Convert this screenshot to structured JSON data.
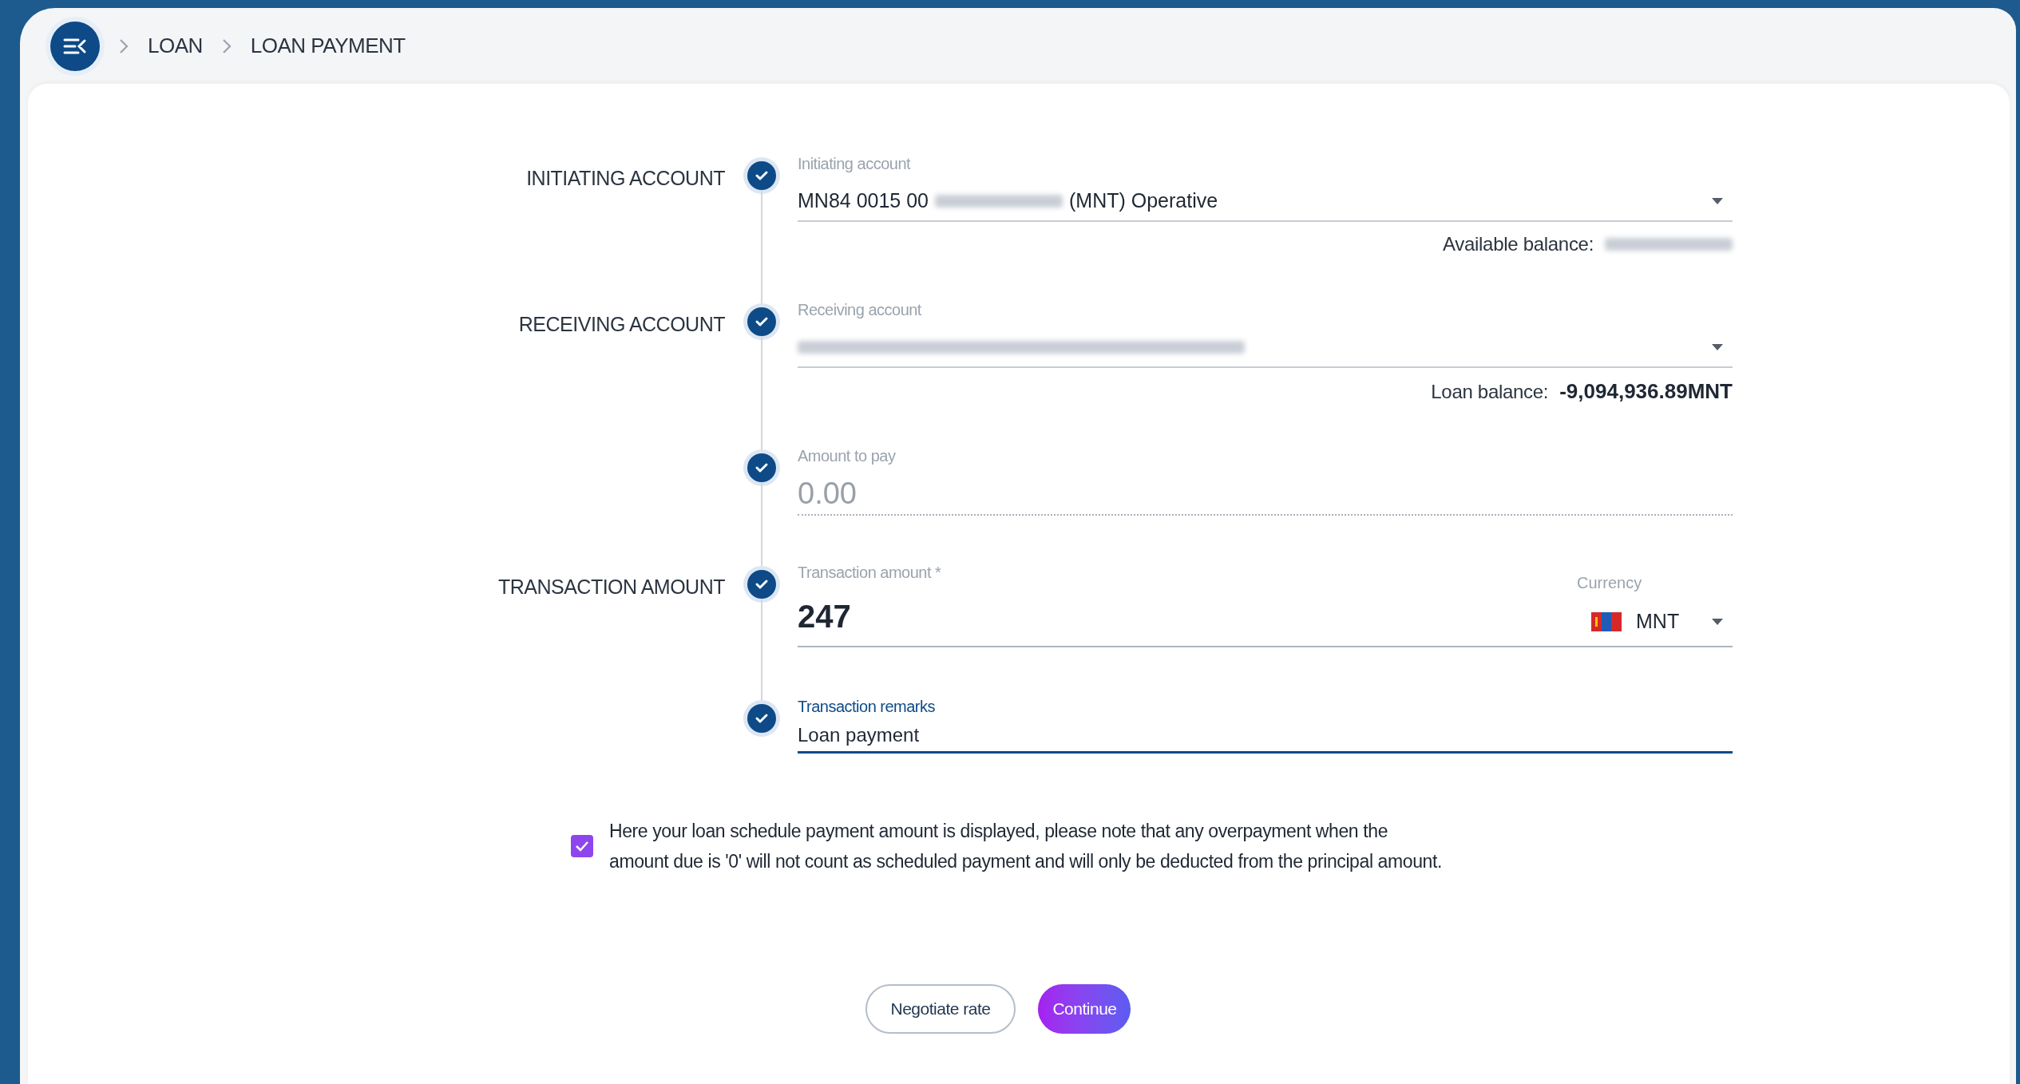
{
  "breadcrumb": [
    {
      "label": "LOAN"
    },
    {
      "label": "LOAN PAYMENT"
    }
  ],
  "steps": [
    {
      "section": "INITIATING ACCOUNT",
      "kind": "select",
      "completed": true,
      "label": "Initiating account",
      "value_parts": [
        {
          "kind": "text",
          "text": "MN84 0015 00"
        },
        {
          "kind": "redacted"
        },
        {
          "kind": "text",
          "text": "(MNT) Operative"
        }
      ],
      "note": {
        "label": "Available balance:",
        "parts": [
          {
            "kind": "redacted"
          }
        ]
      }
    },
    {
      "section": "RECEIVING ACCOUNT",
      "kind": "select",
      "completed": true,
      "label": "Receiving account",
      "value_parts": [
        {
          "kind": "redacted"
        }
      ],
      "note": {
        "label": "Loan balance:",
        "parts": [
          {
            "kind": "text",
            "text": "-9,094,936.89MNT"
          }
        ]
      }
    },
    {
      "kind": "readonly_amount",
      "completed": true,
      "label": "Amount to pay",
      "placeholder": "0.00"
    },
    {
      "section": "TRANSACTION AMOUNT",
      "kind": "amount_currency",
      "completed": true,
      "label": "Transaction amount *",
      "value": "247",
      "currency_label": "Currency",
      "currency": "MNT"
    },
    {
      "kind": "text",
      "completed": true,
      "focused": true,
      "label": "Transaction remarks",
      "value": "Loan payment"
    }
  ],
  "notice": {
    "checked": true,
    "text": "Here your loan schedule payment amount is displayed, please note that any overpayment when the amount due is '0' will not count as scheduled payment and will only be deducted from the principal amount."
  },
  "buttons": [
    {
      "label": "Negotiate rate",
      "kind": "secondary"
    },
    {
      "label": "Continue",
      "kind": "primary"
    }
  ]
}
